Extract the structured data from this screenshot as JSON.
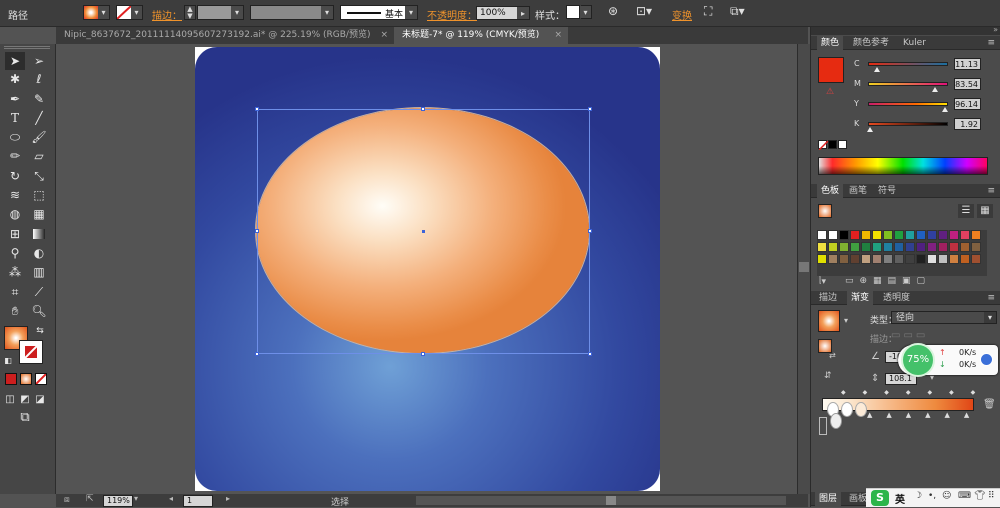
{
  "control_bar": {
    "mode_label": "路径",
    "stroke_label": "描边：",
    "stroke_profile": "基本",
    "opacity_label": "不透明度：",
    "opacity_value": "100%",
    "style_label": "样式：",
    "transform_label": "变换"
  },
  "doc_tabs": [
    {
      "label": "Nipic_8637672_20111114095607273192.ai* @ 225.19% (RGB/预览)",
      "active": false
    },
    {
      "label": "未标题-7* @ 119% (CMYK/预览)",
      "active": true
    }
  ],
  "tab_close_glyph": "×",
  "status_bar": {
    "zoom": "119%",
    "artboard_number": "1",
    "status_text": "选择"
  },
  "color_panel": {
    "tabs": [
      "颜色",
      "颜色参考",
      "Kuler"
    ],
    "fill_color": "#e62b11",
    "channels": [
      {
        "name": "C",
        "value": "11.13",
        "amount": 0.1113
      },
      {
        "name": "M",
        "value": "83.54",
        "amount": 0.8354
      },
      {
        "name": "Y",
        "value": "96.14",
        "amount": 0.9614
      },
      {
        "name": "K",
        "value": "1.92",
        "amount": 0.0192
      }
    ]
  },
  "swatches_panel": {
    "tabs": [
      "色板",
      "画笔",
      "符号"
    ]
  },
  "gradient_panel": {
    "tabs": [
      "描边",
      "渐变",
      "透明度"
    ],
    "type_label": "类型：",
    "type_value": "径向",
    "stroke_label": "描边：",
    "angle_value": "-10",
    "aspect_value": "108.1"
  },
  "speed_widget": {
    "percent": "75%",
    "up": "0K/s",
    "down": "0K/s"
  },
  "bottom_panel_tabs": [
    "图层",
    "画板"
  ],
  "taskbar": {
    "ime_label": "英"
  },
  "icons": [
    "selection-arrow-icon",
    "direct-selection-icon",
    "magic-wand-icon",
    "lasso-icon",
    "pen-icon",
    "curvature-icon",
    "type-icon",
    "line-icon",
    "ellipse-icon",
    "paintbrush-icon",
    "pencil-icon",
    "eraser-icon",
    "rotate-icon",
    "scale-icon",
    "warp-icon",
    "free-transform-icon",
    "shape-builder-icon",
    "perspective-icon",
    "mesh-icon",
    "gradient-icon",
    "eyedropper-icon",
    "blend-icon",
    "symbol-sprayer-icon",
    "column-graph-icon",
    "artboard-icon",
    "slice-icon",
    "hand-icon",
    "zoom-icon"
  ],
  "colors": {
    "accent_orange": "#f0932b",
    "bg_blue_dark": "#27348a",
    "oval_orange": "#ea8d48"
  }
}
